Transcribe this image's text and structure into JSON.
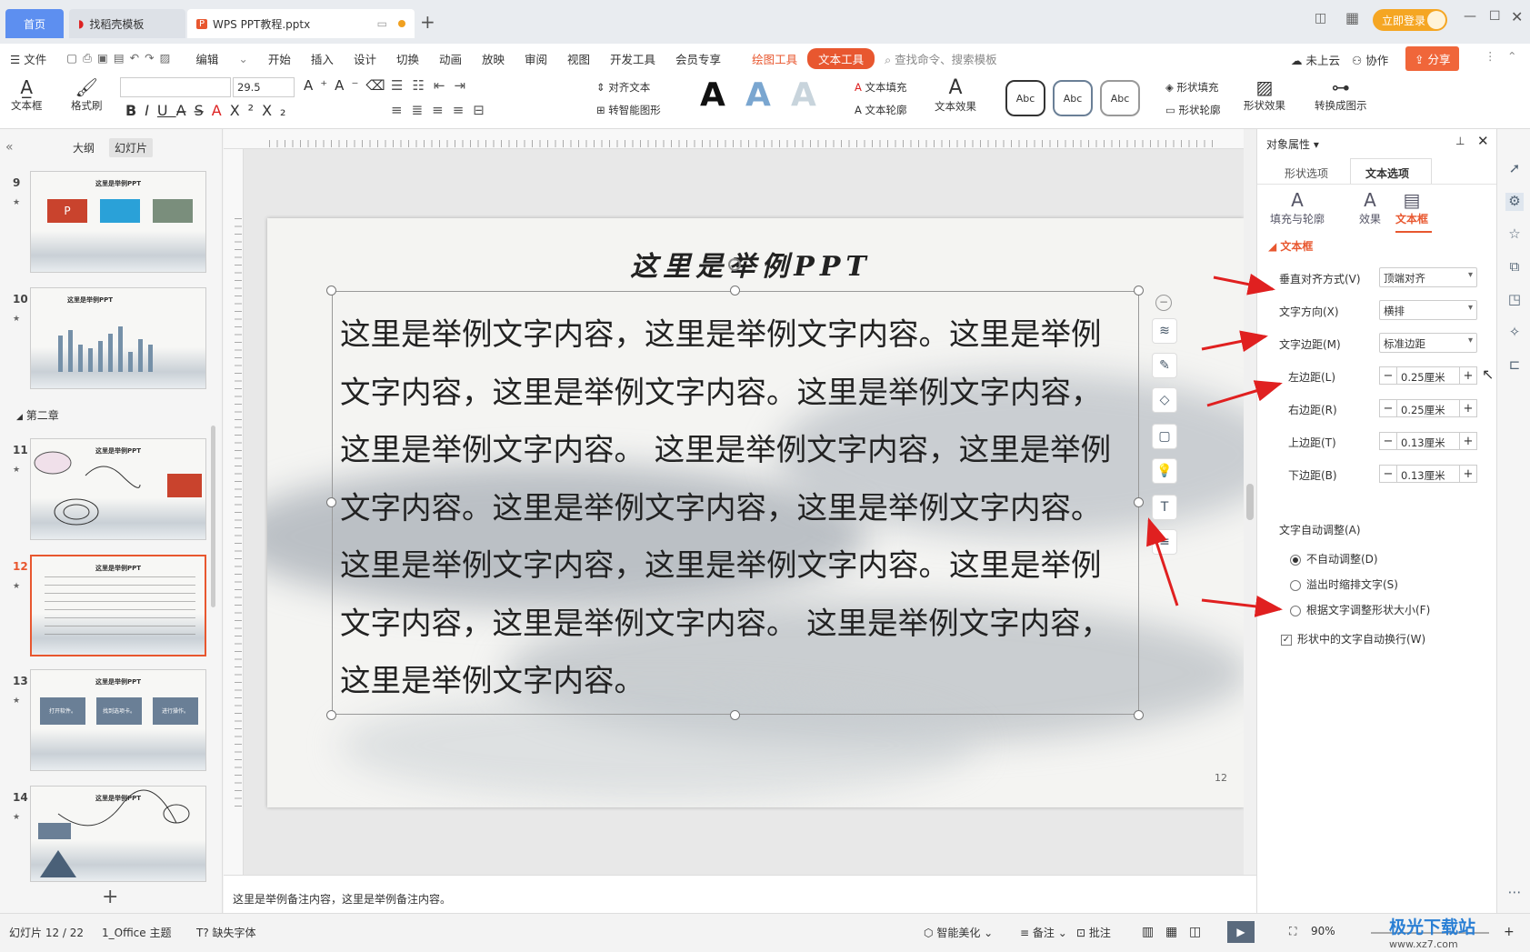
{
  "tabs": {
    "home": "首页",
    "template": "找稻壳模板",
    "doc": "WPS PPT教程.pptx"
  },
  "titlebar": {
    "login": "立即登录"
  },
  "menu": {
    "file": "文件",
    "items": [
      "编辑",
      "开始",
      "插入",
      "设计",
      "切换",
      "动画",
      "放映",
      "审阅",
      "视图",
      "开发工具",
      "会员专享"
    ],
    "draw_tools": "绘图工具",
    "text_tools": "文本工具",
    "search_placeholder": "查找命令、搜索模板",
    "cloud": "未上云",
    "collab": "协作",
    "share": "分享"
  },
  "ribbon": {
    "textbox": "文本框",
    "format_painter": "格式刷",
    "font_size": "29.5",
    "align_text": "对齐文本",
    "smart_shape": "转智能图形",
    "text_fill": "文本填充",
    "text_outline": "文本轮廓",
    "text_effect": "文本效果",
    "style_sample": "Abc",
    "shape_fill": "形状填充",
    "shape_outline": "形状轮廓",
    "shape_effect": "形状效果",
    "convert_diagram": "转换成图示"
  },
  "leftpanel": {
    "tab_outline": "大纲",
    "tab_slides": "幻灯片",
    "chapter": "第二章",
    "slides": [
      {
        "num": "9",
        "title": "这里是举例PPT"
      },
      {
        "num": "10",
        "title": "这里是举例PPT"
      },
      {
        "num": "11",
        "title": "这里是举例PPT"
      },
      {
        "num": "12",
        "title": "这里是举例PPT"
      },
      {
        "num": "13",
        "title": "这里是举例PPT",
        "boxes": [
          "打开软件。",
          "找到选项卡。",
          "进行操作。"
        ]
      },
      {
        "num": "14",
        "title": "这里是举例PPT"
      }
    ]
  },
  "slide": {
    "title": "这里是举例PPT",
    "body": "这里是举例文字内容，这里是举例文字内容。这里是举例文字内容，这里是举例文字内容。这里是举例文字内容，这里是举例文字内容。 这里是举例文字内容，这里是举例文字内容。这里是举例文字内容，这里是举例文字内容。这里是举例文字内容，这里是举例文字内容。这里是举例文字内容，这里是举例文字内容。 这里是举例文字内容，这里是举例文字内容。",
    "page_number": "12"
  },
  "notes": "这里是举例备注内容，这里是举例备注内容。",
  "rpanel": {
    "title": "对象属性",
    "tab_shape": "形状选项",
    "tab_text": "文本选项",
    "sub_fill": "填充与轮廓",
    "sub_effect": "效果",
    "sub_textbox": "文本框",
    "section": "文本框",
    "valign_label": "垂直对齐方式(V)",
    "valign_value": "顶端对齐",
    "dir_label": "文字方向(X)",
    "dir_value": "横排",
    "margin_label": "文字边距(M)",
    "margin_value": "标准边距",
    "left_label": "左边距(L)",
    "left_value": "0.25厘米",
    "right_label": "右边距(R)",
    "right_value": "0.25厘米",
    "top_label": "上边距(T)",
    "top_value": "0.13厘米",
    "bottom_label": "下边距(B)",
    "bottom_value": "0.13厘米",
    "autofit_label": "文字自动调整(A)",
    "opt_none": "不自动调整(D)",
    "opt_shrink": "溢出时缩排文字(S)",
    "opt_resize": "根据文字调整形状大小(F)",
    "wrap": "形状中的文字自动换行(W)"
  },
  "status": {
    "slide": "幻灯片 12 / 22",
    "theme": "1_Office 主题",
    "missing_font": "缺失字体",
    "beautify": "智能美化",
    "notes": "备注",
    "comments": "批注",
    "zoom": "90%"
  },
  "watermark": {
    "site": "极光下载站",
    "url": "www.xz7.com"
  },
  "colors": {
    "accent": "#e8572f",
    "tab_blue": "#5d8ff0",
    "arrow": "#e02020"
  }
}
